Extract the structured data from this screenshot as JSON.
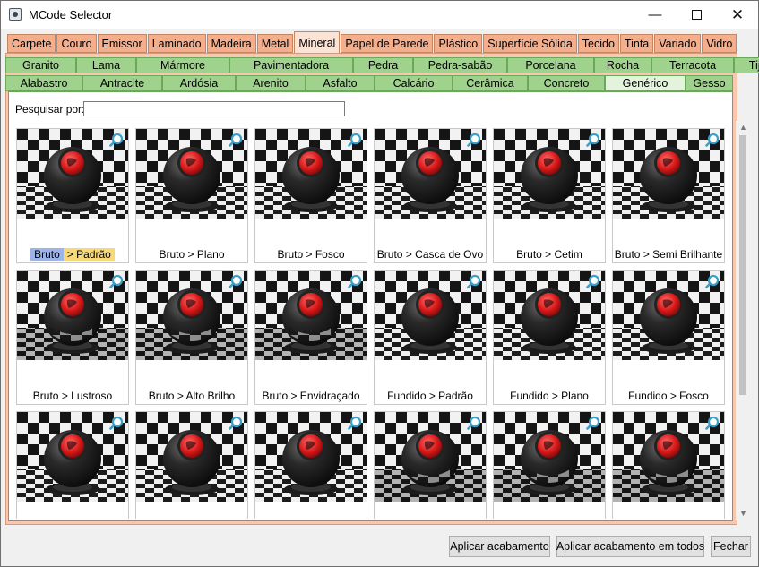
{
  "window": {
    "title": "MCode Selector"
  },
  "category_tabs": [
    "Carpete",
    "Couro",
    "Emissor",
    "Laminado",
    "Madeira",
    "Metal",
    "Mineral",
    "Papel de Parede",
    "Plástico",
    "Superfície Sólida",
    "Tecido",
    "Tinta",
    "Variado",
    "Vidro"
  ],
  "active_category": "Mineral",
  "subtabs_row1": [
    "Granito",
    "Lama",
    "Mármore",
    "Pavimentadora",
    "Pedra",
    "Pedra-sabão",
    "Porcelana",
    "Rocha",
    "Terracota",
    "Tijolo"
  ],
  "subtabs_row2": [
    "Alabastro",
    "Antracite",
    "Ardósia",
    "Arenito",
    "Asfalto",
    "Calcário",
    "Cerâmica",
    "Concreto",
    "Genérico",
    "Gesso"
  ],
  "active_subtab": "Genérico",
  "search": {
    "label": "Pesquisar por:",
    "value": ""
  },
  "items": [
    {
      "part1": "Bruto",
      "part2": "Padrão",
      "selected": true,
      "style": "plain"
    },
    {
      "label": "Bruto > Plano",
      "style": "plain"
    },
    {
      "label": "Bruto > Fosco",
      "style": "plain"
    },
    {
      "label": "Bruto > Casca de Ovo",
      "style": "plain"
    },
    {
      "label": "Bruto > Cetim",
      "style": "plain"
    },
    {
      "label": "Bruto > Semi Brilhante",
      "style": "plain"
    },
    {
      "label": "Bruto > Lustroso",
      "style": "reflect"
    },
    {
      "label": "Bruto > Alto Brilho",
      "style": "reflect"
    },
    {
      "label": "Bruto > Envidraçado",
      "style": "reflect"
    },
    {
      "label": "Fundido > Padrão",
      "style": "plain"
    },
    {
      "label": "Fundido > Plano",
      "style": "plain"
    },
    {
      "label": "Fundido > Fosco",
      "style": "plain"
    },
    {
      "label": "",
      "style": "plain"
    },
    {
      "label": "",
      "style": "plain"
    },
    {
      "label": "",
      "style": "plain"
    },
    {
      "label": "",
      "style": "reflect"
    },
    {
      "label": "",
      "style": "reflect"
    },
    {
      "label": "",
      "style": "reflect"
    }
  ],
  "buttons": {
    "apply": "Aplicar acabamento",
    "apply_all": "Aplicar acabamento em todos",
    "close": "Fechar"
  },
  "icons": {
    "app": "app-window-icon",
    "zoom": "magnifier-icon"
  },
  "colors": {
    "category_tab": "#f4ae8c",
    "subtab": "#9fd38d",
    "selection_left": "#9fb4e6",
    "selection_right": "#f8d97a"
  }
}
